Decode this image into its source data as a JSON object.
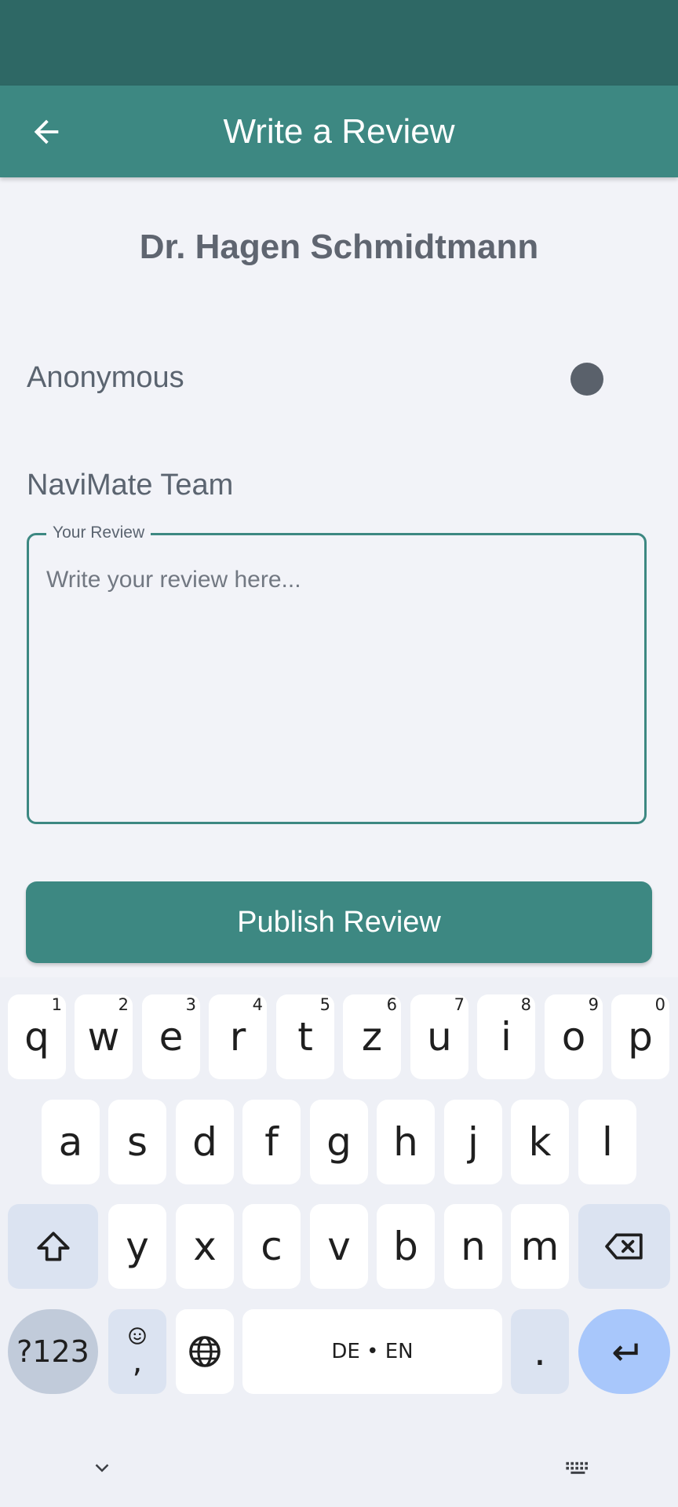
{
  "app_bar": {
    "title": "Write a Review",
    "back_icon": "arrow-left-icon"
  },
  "doctor": {
    "name": "Dr. Hagen Schmidtmann"
  },
  "anonymous": {
    "label": "Anonymous",
    "enabled": false
  },
  "team": {
    "label": "NaviMate Team"
  },
  "review": {
    "label": "Your Review",
    "placeholder": "Write your review here...",
    "value": ""
  },
  "publish": {
    "label": "Publish Review"
  },
  "keyboard": {
    "row1": [
      {
        "key": "q",
        "hint": "1"
      },
      {
        "key": "w",
        "hint": "2"
      },
      {
        "key": "e",
        "hint": "3"
      },
      {
        "key": "r",
        "hint": "4"
      },
      {
        "key": "t",
        "hint": "5"
      },
      {
        "key": "z",
        "hint": "6"
      },
      {
        "key": "u",
        "hint": "7"
      },
      {
        "key": "i",
        "hint": "8"
      },
      {
        "key": "o",
        "hint": "9"
      },
      {
        "key": "p",
        "hint": "0"
      }
    ],
    "row2": [
      "a",
      "s",
      "d",
      "f",
      "g",
      "h",
      "j",
      "k",
      "l"
    ],
    "row3": [
      "y",
      "x",
      "c",
      "v",
      "b",
      "n",
      "m"
    ],
    "symbols_label": "?123",
    "emoji_comma": ",",
    "space_label": "DE • EN",
    "period": ".",
    "icons": [
      "shift-icon",
      "backspace-icon",
      "emoji-icon",
      "globe-icon",
      "enter-icon",
      "chevron-down-icon",
      "keyboard-icon"
    ]
  },
  "colors": {
    "status_bar": "#2e6865",
    "app_bar": "#3d8882",
    "accent": "#3d8882",
    "background": "#f2f3f8"
  }
}
